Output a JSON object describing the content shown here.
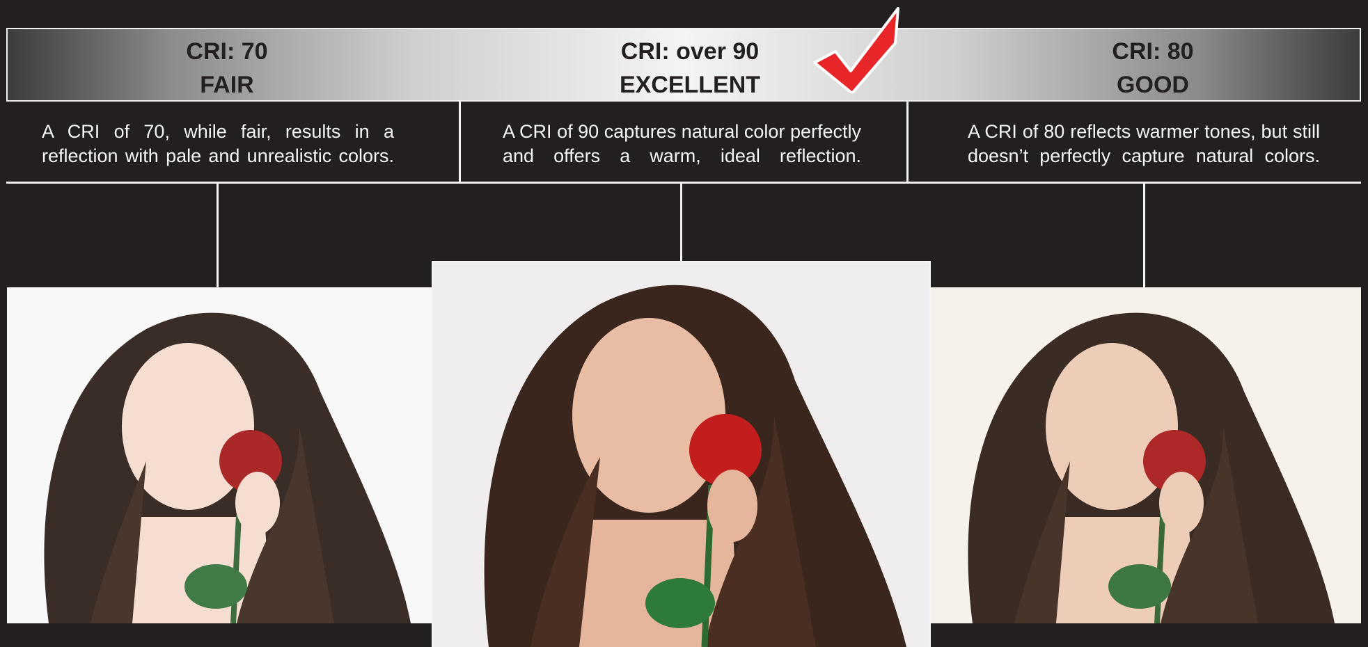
{
  "panels": [
    {
      "cri": "CRI: 70",
      "rating": "FAIR",
      "description": "A CRI of 70, while fair, results in a reflection with pale and unrealistic colors."
    },
    {
      "cri": "CRI: over 90",
      "rating": "EXCELLENT",
      "description": "A CRI of 90 captures natural color perfectly and offers a warm, ideal reflection."
    },
    {
      "cri": "CRI: 80",
      "rating": "GOOD",
      "description": "A CRI of 80 reflects warmer tones, but still doesn’t perfectly capture natural colors."
    }
  ],
  "colors": {
    "background": "#231f20",
    "line": "#f2f2f2",
    "checkmark": "#e8262a",
    "rose": "#c41d1d"
  },
  "icons": {
    "checkmark": "checkmark-icon"
  }
}
